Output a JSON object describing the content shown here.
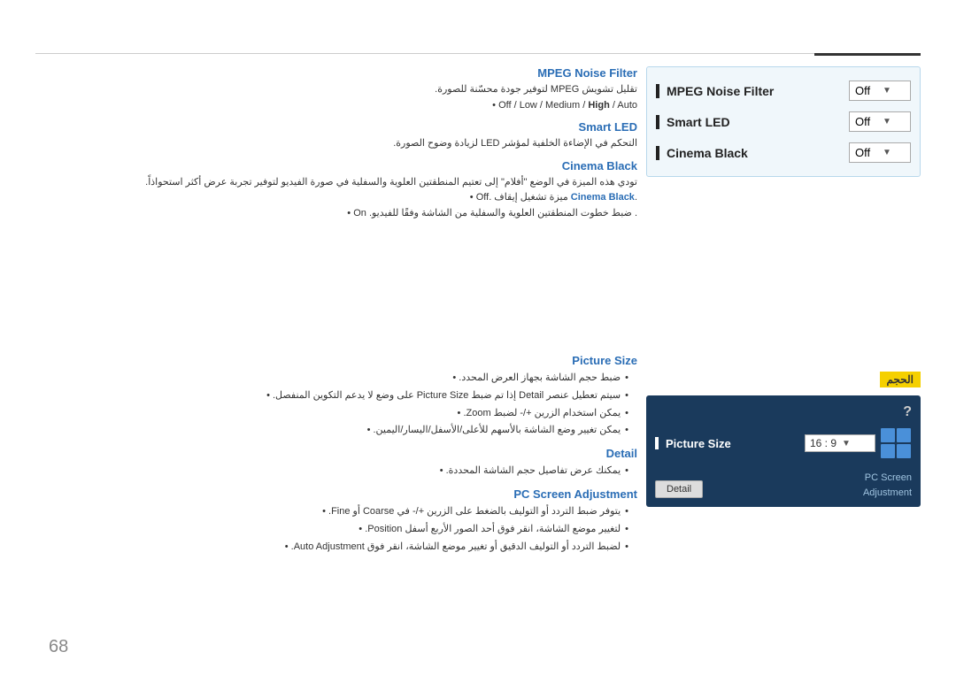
{
  "page": {
    "number": "68",
    "top_accent_color": "#333333",
    "top_line_color": "#cccccc"
  },
  "top_section": {
    "mpeg_title": "MPEG Noise Filter",
    "mpeg_desc": "تقليل تشويش MPEG لتوفير جودة محسّنة للصورة.",
    "mpeg_options": "Off / Low / Medium / High / Auto •",
    "smart_led_title": "Smart LED",
    "smart_led_desc": "التحكم في الإضاءة الخلفية لمؤشر LED لزيادة وضوح الصورة.",
    "cinema_black_title": "Cinema Black",
    "cinema_black_desc": "تودي هذه الميزة في الوضع \"أفلام\" إلى تعتيم المنطقتين العلوية والسفلية في صورة الفيديو لتوفير تجربة عرض أكثر استحواذاً.",
    "cinema_off_text": ".Cinema Black ميزة تشغيل إيقاف .Off •",
    "cinema_on_text": ". ضبط خطوت المنطقتين العلوية والسفلية من الشاشة وفقًا للفيديو. On •"
  },
  "bottom_section": {
    "picture_size_title": "Picture Size",
    "picture_size_bullets": [
      "ضبط حجم الشاشة بجهاز العرض المحدد. •",
      "سيتم تعطيل عنصر Detail إذا تم ضبط Picture Size على وضع لا يدعم التكوين المنفصل. •",
      "يمكن استخدام الزرين +/- لضبط Zoom. •",
      "يمكن تغيير وضع الشاشة بالأسهم للأعلى/الأسفل/اليسار/اليمين. •"
    ],
    "detail_title": "Detail",
    "detail_bullets": [
      "يمكنك عرض تفاصيل حجم الشاشة المحددة. •"
    ],
    "pc_adjustment_title": "PC Screen Adjustment",
    "pc_adjustment_bullets": [
      "يتوفر ضبط التردد أو التوليف بالضغط على الزرين +/- في Coarse أو Fine. •",
      "لتغيير موضع الشاشة، انقر فوق أحد الصور الأربع أسفل Position. •",
      "لضبط التردد أو التوليف الدقيق أو تغيير موضع الشاشة، انقر فوق Auto Adjustment. •"
    ]
  },
  "right_top_panel": {
    "items": [
      {
        "label": "MPEG Noise Filter",
        "value": "Off"
      },
      {
        "label": "Smart LED",
        "value": "Off"
      },
      {
        "label": "Cinema Black",
        "value": "Off"
      }
    ]
  },
  "right_bottom_panel": {
    "arabic_label": "الحجم",
    "question_mark": "?",
    "picture_size_label": "Picture Size",
    "picture_size_value": "16 : 9",
    "detail_button": "Detail",
    "pc_screen_label": "PC Screen",
    "adjustment_label": "Adjustment"
  }
}
